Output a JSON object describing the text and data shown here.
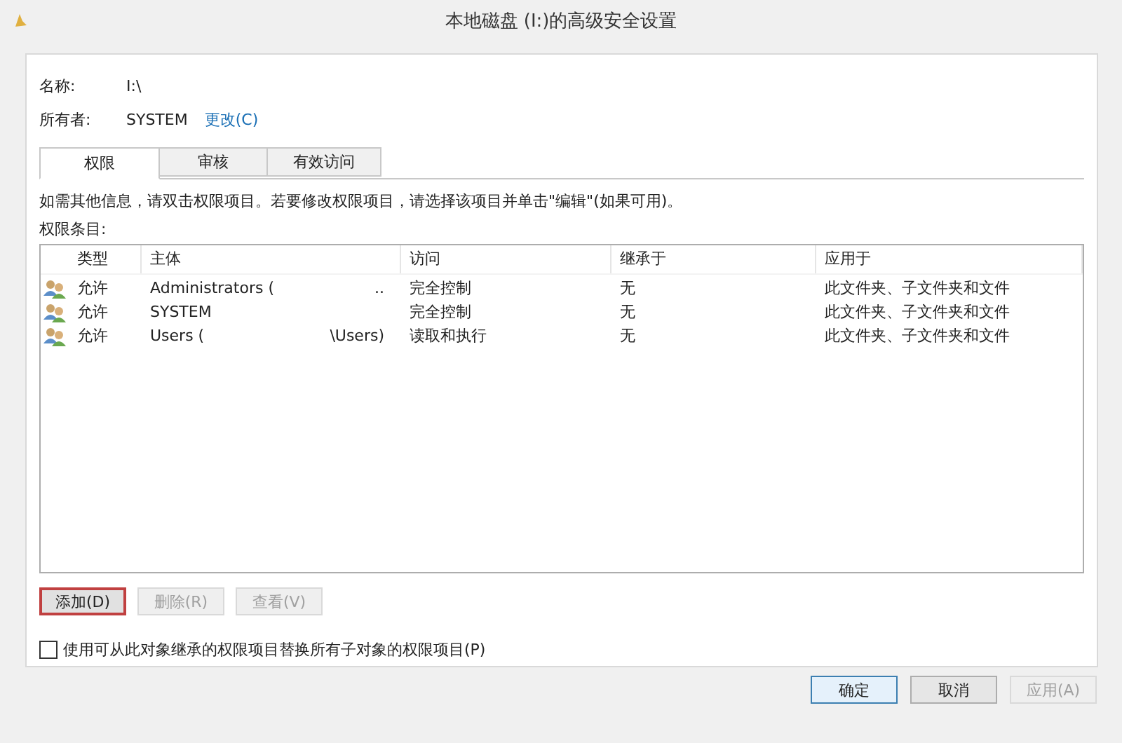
{
  "window": {
    "title": "本地磁盘 (I:)的高级安全设置"
  },
  "name": {
    "label": "名称:",
    "value": "I:\\"
  },
  "owner": {
    "label": "所有者:",
    "value": "SYSTEM",
    "link": "更改(C)"
  },
  "tabs": [
    {
      "label": "权限",
      "selected": true
    },
    {
      "label": "审核",
      "selected": false
    },
    {
      "label": "有效访问",
      "selected": false
    }
  ],
  "info": "如需其他信息，请双击权限项目。若要修改权限项目，请选择该项目并单击\"编辑\"(如果可用)。",
  "entries_label": "权限条目:",
  "table": {
    "columns": [
      "类型",
      "主体",
      "访问",
      "继承于",
      "应用于"
    ],
    "rows": [
      {
        "type": "允许",
        "principal": "Administrators (",
        "principal_tail": "..",
        "access": "完全控制",
        "inherited": "无",
        "applies": "此文件夹、子文件夹和文件"
      },
      {
        "type": "允许",
        "principal": "SYSTEM",
        "principal_tail": "",
        "access": "完全控制",
        "inherited": "无",
        "applies": "此文件夹、子文件夹和文件"
      },
      {
        "type": "允许",
        "principal": "Users (",
        "principal_tail": "\\Users)",
        "access": "读取和执行",
        "inherited": "无",
        "applies": "此文件夹、子文件夹和文件"
      }
    ]
  },
  "actions": [
    {
      "label": "添加(D)",
      "disabled": false,
      "highlighted": true
    },
    {
      "label": "删除(R)",
      "disabled": true,
      "highlighted": false
    },
    {
      "label": "查看(V)",
      "disabled": true,
      "highlighted": false
    }
  ],
  "replace_checkbox": {
    "label": "使用可从此对象继承的权限项目替换所有子对象的权限项目(P)",
    "checked": false
  },
  "buttons": [
    {
      "label": "确定",
      "disabled": false,
      "default": true
    },
    {
      "label": "取消",
      "disabled": false,
      "default": false
    },
    {
      "label": "应用(A)",
      "disabled": true,
      "default": false
    }
  ]
}
